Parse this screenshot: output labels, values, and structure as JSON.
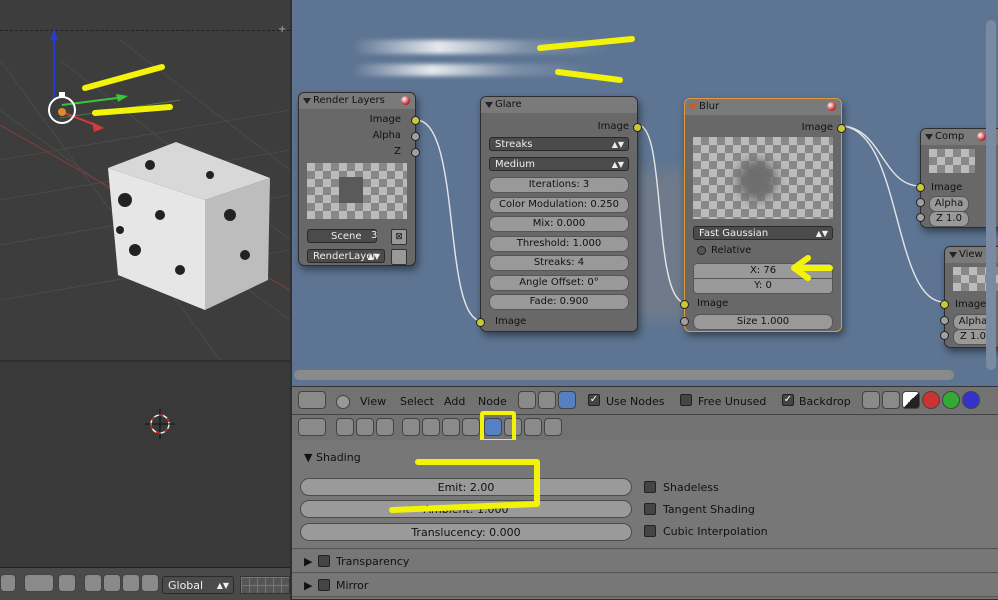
{
  "viewport": {
    "header": {
      "orientation": "Global"
    }
  },
  "nodes": {
    "render_layers": {
      "title": "Render Layers",
      "outputs": [
        "Image",
        "Alpha",
        "Z"
      ],
      "scene": "Scene",
      "scene_users": "3",
      "layer": "RenderLayer"
    },
    "glare": {
      "title": "Glare",
      "output": "Image",
      "type": "Streaks",
      "quality": "Medium",
      "fields": [
        "Iterations: 3",
        "Color Modulation: 0.250",
        "Mix: 0.000",
        "Threshold: 1.000",
        "Streaks: 4",
        "Angle Offset: 0°",
        "Fade: 0.900"
      ],
      "input": "Image"
    },
    "blur": {
      "title": "Blur",
      "output": "Image",
      "filter": "Fast Gaussian",
      "relative_label": "Relative",
      "x_field": "X: 76",
      "y_field": "Y: 0",
      "input_image": "Image",
      "size_field": "Size 1.000"
    },
    "composite": {
      "title": "Comp",
      "inputs": [
        "Image",
        "Alpha",
        "Z 1.0"
      ]
    },
    "viewer": {
      "title": "View",
      "inputs": [
        "Image",
        "Alpha",
        "Z 1.0"
      ]
    }
  },
  "node_header": {
    "menus": [
      "View",
      "Select",
      "Add",
      "Node"
    ],
    "use_nodes": "Use Nodes",
    "free_unused": "Free Unused",
    "backdrop": "Backdrop"
  },
  "properties": {
    "shading": {
      "title": "Shading",
      "emit": "Emit: 2.00",
      "ambient": "Ambient: 1.000",
      "translucency": "Translucency: 0.000",
      "shadeless": "Shadeless",
      "tangent_shading": "Tangent Shading",
      "cubic_interpolation": "Cubic Interpolation"
    },
    "panels": [
      "Transparency",
      "Mirror"
    ]
  },
  "colors": {
    "annotation": "#f3f30a",
    "node_bg": "#5d7593"
  }
}
